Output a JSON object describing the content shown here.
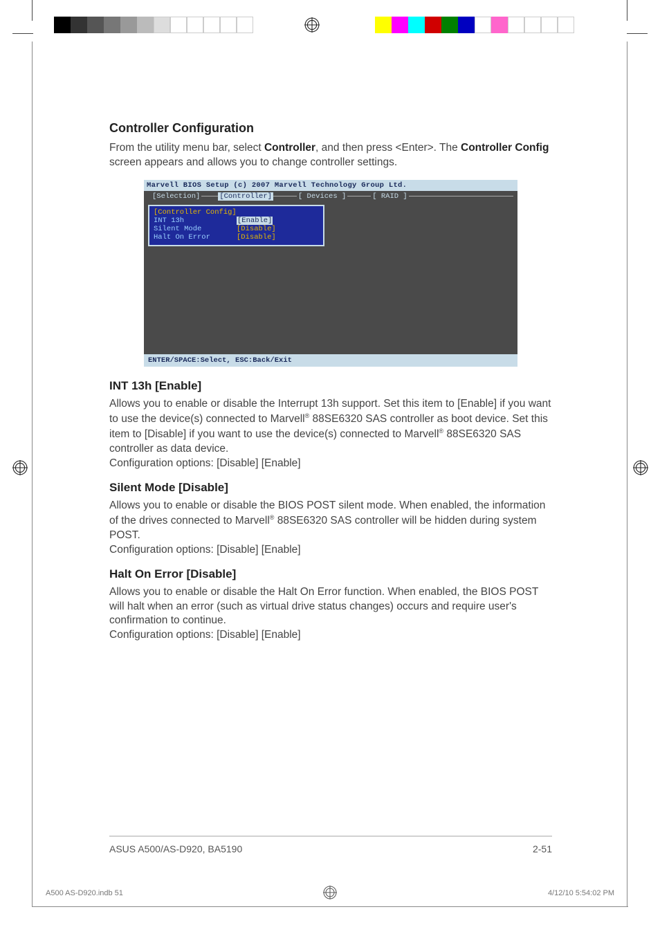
{
  "crop": {
    "left_swatches": [
      "#000000",
      "#3a3a3a",
      "#5a5a5a",
      "#7a7a7a",
      "#9a9a9a",
      "#bababa",
      "#dadada",
      "#ffffff",
      "#ffffff",
      "#ffffff",
      "#ffffff",
      "#ffffff"
    ],
    "right_swatches": [
      "#ffff00",
      "#ff00ff",
      "#00ffff",
      "#e00000",
      "#008000",
      "#0000d0",
      "#ffffff",
      "#ff66cc",
      "#ffffff",
      "#ffffff",
      "#ffffff",
      "#ffffff"
    ]
  },
  "page": {
    "title": "Controller Configuration",
    "intro_pre": "From the utility menu bar, select ",
    "intro_bold1": "Controller",
    "intro_mid": ", and then press <Enter>. The ",
    "intro_bold2": "Controller Config",
    "intro_post": " screen appears and allows you to change controller settings."
  },
  "bios": {
    "title": "Marvell BIOS Setup (c) 2007 Marvell Technology Group Ltd.",
    "menu": {
      "selection": "[Selection]",
      "controller": "[Controller]",
      "devices": "[ Devices ]",
      "raid": "[  RAID  ]"
    },
    "config": {
      "header": "[Controller Config]",
      "rows": [
        {
          "label": "INT 13h",
          "value": "[Enable]",
          "highlight": true
        },
        {
          "label": "Silent Mode",
          "value": "[Disable]",
          "highlight": false
        },
        {
          "label": "Halt On Error",
          "value": "[Disable]",
          "highlight": false
        }
      ]
    },
    "footer": "ENTER/SPACE:Select, ESC:Back/Exit"
  },
  "sections": [
    {
      "heading": "INT 13h [Enable]",
      "body_parts": [
        "Allows you to enable or disable the Interrupt 13h support. Set this item to [Enable] if you want to use the device(s) connected to Marvell",
        " 88SE6320 SAS controller as boot device. Set this item to [Disable] if you want to use the device(s) connected to Marvell",
        " 88SE6320 SAS controller as data device."
      ],
      "options": "Configuration options: [Disable] [Enable]"
    },
    {
      "heading": "Silent Mode [Disable]",
      "body_parts": [
        "Allows you to enable or disable the BIOS POST silent mode. When enabled, the information of the drives connected to Marvell",
        " 88SE6320 SAS controller will be hidden during system POST."
      ],
      "options": "Configuration options: [Disable] [Enable]"
    },
    {
      "heading": "Halt On Error [Disable]",
      "body_plain": "Allows you to enable or disable the Halt On Error function. When enabled, the BIOS POST will halt when an error (such as virtual drive status changes) occurs and require user's confirmation to continue.",
      "options": "Configuration options: [Disable] [Enable]"
    }
  ],
  "footer": {
    "left": "ASUS A500/AS-D920, BA5190",
    "right": "2-51"
  },
  "print_meta": {
    "left": "A500 AS-D920.indb   51",
    "right": "4/12/10   5:54:02 PM"
  },
  "reg_sup": "®"
}
